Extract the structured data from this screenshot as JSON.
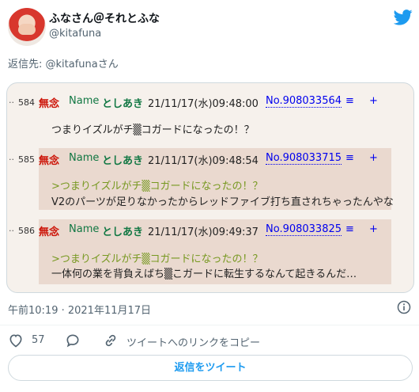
{
  "user": {
    "display_name": "ふなさん＠それとふな",
    "handle": "@kitafuna"
  },
  "reply_to": {
    "prefix": "返信先: ",
    "mention": "@kitafuna",
    "suffix": "さん"
  },
  "posts": [
    {
      "number": "584",
      "subject": "無念",
      "name_label": "Name",
      "poster": "としあき",
      "datetime": "21/11/17(水)09:48:00",
      "post_no": "No.908033564",
      "lines": [
        {
          "text": "つまりイズルがチ▒コガードになったの！？",
          "quote": false
        }
      ]
    },
    {
      "number": "585",
      "subject": "無念",
      "name_label": "Name",
      "poster": "としあき",
      "datetime": "21/11/17(水)09:48:54",
      "post_no": "No.908033715",
      "lines": [
        {
          "text": ">つまりイズルがチ▒コガードになったの！？",
          "quote": true
        },
        {
          "text": "V2のパーツが足りなかったからレッドファイブ打ち直されちゃったんやな",
          "quote": false
        }
      ]
    },
    {
      "number": "586",
      "subject": "無念",
      "name_label": "Name",
      "poster": "としあき",
      "datetime": "21/11/17(水)09:49:37",
      "post_no": "No.908033825",
      "lines": [
        {
          "text": ">つまりイズルがチ▒コガードになったの！？",
          "quote": true
        },
        {
          "text": "一体何の業を背負えばち▒こガードに転生するなんて起きるんだ…",
          "quote": false
        }
      ]
    }
  ],
  "post_menu": "≡",
  "post_plus": "+",
  "post_dots": "··",
  "timestamp": "午前10:19 · 2021年11月17日",
  "actions": {
    "like_count": "57",
    "copy_link": "ツイートへのリンクをコピー"
  },
  "reply_button": "返信をツイート",
  "colors": {
    "accent": "#1d9bf0",
    "subject": "#cc1105",
    "name": "#117743",
    "quote": "#789922"
  }
}
